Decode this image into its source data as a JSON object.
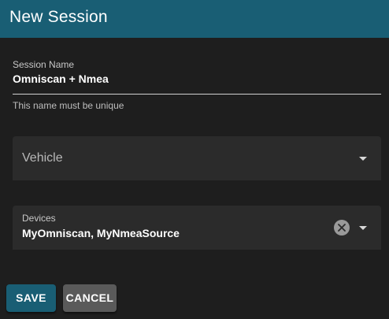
{
  "dialog": {
    "title": "New Session"
  },
  "session_name": {
    "label": "Session Name",
    "value": "Omniscan + Nmea",
    "hint": "This name must be unique"
  },
  "vehicle": {
    "placeholder": "Vehicle"
  },
  "devices": {
    "label": "Devices",
    "value": "MyOmniscan, MyNmeaSource"
  },
  "actions": {
    "save_label": "SAVE",
    "cancel_label": "CANCEL"
  },
  "icons": {
    "vehicle_dropdown": "chevron-down-icon",
    "devices_dropdown": "chevron-down-icon",
    "devices_clear": "close-circle-icon"
  },
  "colors": {
    "header": "#195e74",
    "background": "#1e1e1e",
    "field": "#2b2b2b",
    "save_button": "#195e74",
    "cancel_button": "#5a5a5a"
  }
}
